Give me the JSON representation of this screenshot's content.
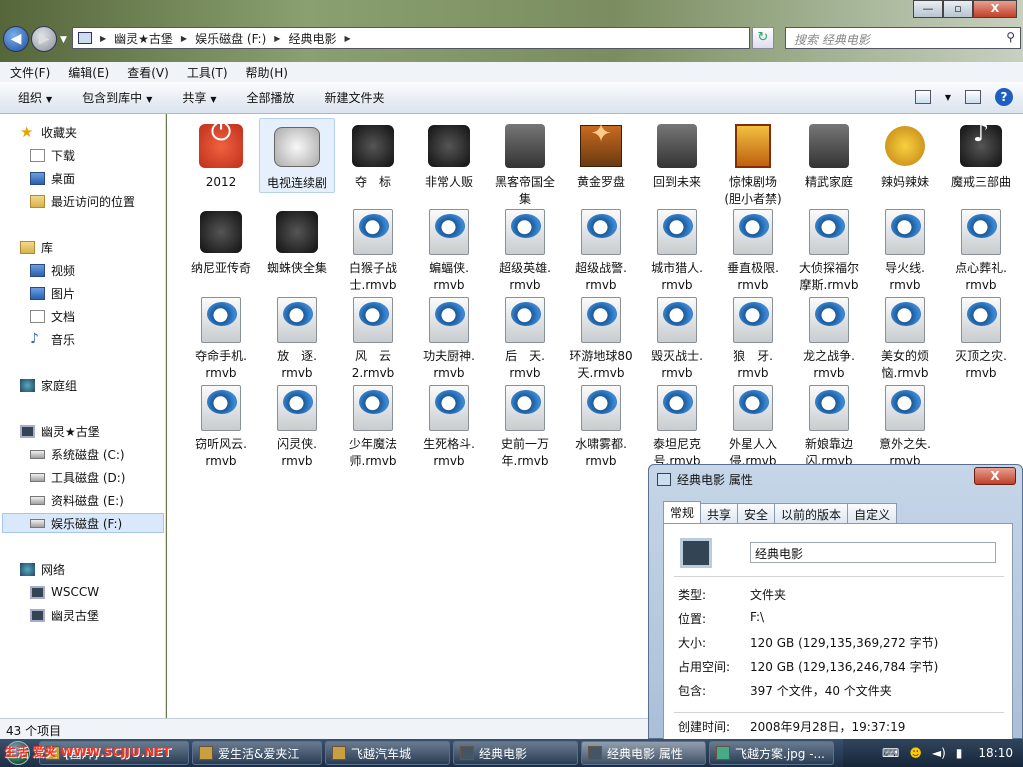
{
  "window": {
    "controls": {
      "minimize": "—",
      "maximize": "▫",
      "close": "X"
    },
    "address": {
      "crumbs": [
        "幽灵★古堡",
        "娱乐磁盘 (F:)",
        "经典电影"
      ]
    },
    "search_placeholder": "搜索 经典电影"
  },
  "menu": [
    "文件(F)",
    "编辑(E)",
    "查看(V)",
    "工具(T)",
    "帮助(H)"
  ],
  "toolbar": [
    {
      "label": "组织",
      "dropdown": true
    },
    {
      "label": "包含到库中",
      "dropdown": true
    },
    {
      "label": "共享",
      "dropdown": true
    },
    {
      "label": "全部播放",
      "dropdown": false
    },
    {
      "label": "新建文件夹",
      "dropdown": false
    }
  ],
  "nav": {
    "favorites": {
      "label": "收藏夹",
      "items": [
        "下载",
        "桌面",
        "最近访问的位置"
      ]
    },
    "libraries": {
      "label": "库",
      "items": [
        "视频",
        "图片",
        "文档",
        "音乐"
      ]
    },
    "homegroup": "家庭组",
    "computer": {
      "label": "幽灵★古堡",
      "items": [
        "系统磁盘 (C:)",
        "工具磁盘 (D:)",
        "资料磁盘 (E:)",
        "娱乐磁盘 (F:)"
      ]
    },
    "network": {
      "label": "网络",
      "items": [
        "WSCCW",
        "幽灵古堡"
      ]
    }
  },
  "files": [
    {
      "l1": "2012",
      "l2": "",
      "icon": "power-icon"
    },
    {
      "l1": "电视连续剧",
      "l2": "",
      "icon": "tv-icon"
    },
    {
      "l1": "夺　标",
      "l2": "",
      "icon": "robot-icon"
    },
    {
      "l1": "非常人贩",
      "l2": "",
      "icon": "folder-dark-icon"
    },
    {
      "l1": "黑客帝国全",
      "l2": "集",
      "icon": "box-icon"
    },
    {
      "l1": "黄金罗盘",
      "l2": "",
      "icon": "compass-box-icon"
    },
    {
      "l1": "回到未来",
      "l2": "",
      "icon": "gray-box-icon"
    },
    {
      "l1": "惊悚剧场",
      "l2": "(胆小者禁)",
      "icon": "poster-icon"
    },
    {
      "l1": "精武家庭",
      "l2": "",
      "icon": "gray-box-icon"
    },
    {
      "l1": "辣妈辣妹",
      "l2": "",
      "icon": "magnifier-icon"
    },
    {
      "l1": "魔戒三部曲",
      "l2": "",
      "icon": "music-disc-icon"
    },
    {
      "l1": "纳尼亚传奇",
      "l2": "",
      "icon": "machine-icon"
    },
    {
      "l1": "蜘蛛侠全集",
      "l2": "",
      "icon": "speaker-icon"
    },
    {
      "l1": "白猴子战",
      "l2": "士.rmvb",
      "icon": "rmvb-icon"
    },
    {
      "l1": "蝙蝠侠.",
      "l2": "rmvb",
      "icon": "rmvb-icon"
    },
    {
      "l1": "超级英雄.",
      "l2": "rmvb",
      "icon": "rmvb-icon"
    },
    {
      "l1": "超级战警.",
      "l2": "rmvb",
      "icon": "rmvb-icon"
    },
    {
      "l1": "城市猎人.",
      "l2": "rmvb",
      "icon": "rmvb-icon"
    },
    {
      "l1": "垂直极限.",
      "l2": "rmvb",
      "icon": "rmvb-icon"
    },
    {
      "l1": "大侦探福尔",
      "l2": "摩斯.rmvb",
      "icon": "rmvb-icon"
    },
    {
      "l1": "导火线.",
      "l2": "rmvb",
      "icon": "rmvb-icon"
    },
    {
      "l1": "点心葬礼.",
      "l2": "rmvb",
      "icon": "rmvb-icon"
    },
    {
      "l1": "夺命手机.",
      "l2": "rmvb",
      "icon": "rmvb-icon"
    },
    {
      "l1": "放　逐.",
      "l2": "rmvb",
      "icon": "rmvb-icon"
    },
    {
      "l1": "风　云",
      "l2": "2.rmvb",
      "icon": "rmvb-icon"
    },
    {
      "l1": "功夫厨神.",
      "l2": "rmvb",
      "icon": "rmvb-icon"
    },
    {
      "l1": "后　天.",
      "l2": "rmvb",
      "icon": "rmvb-icon"
    },
    {
      "l1": "环游地球80",
      "l2": "天.rmvb",
      "icon": "rmvb-icon"
    },
    {
      "l1": "毁灭战士.",
      "l2": "rmvb",
      "icon": "rmvb-icon"
    },
    {
      "l1": "狼　牙.",
      "l2": "rmvb",
      "icon": "rmvb-icon"
    },
    {
      "l1": "龙之战争.",
      "l2": "rmvb",
      "icon": "rmvb-icon"
    },
    {
      "l1": "美女的烦",
      "l2": "恼.rmvb",
      "icon": "rmvb-icon"
    },
    {
      "l1": "灭顶之灾.",
      "l2": "rmvb",
      "icon": "rmvb-icon"
    },
    {
      "l1": "窃听风云.",
      "l2": "rmvb",
      "icon": "rmvb-icon"
    },
    {
      "l1": "闪灵侠.",
      "l2": "rmvb",
      "icon": "rmvb-icon"
    },
    {
      "l1": "少年魔法",
      "l2": "师.rmvb",
      "icon": "rmvb-icon"
    },
    {
      "l1": "生死格斗.",
      "l2": "rmvb",
      "icon": "rmvb-icon"
    },
    {
      "l1": "史前一万",
      "l2": "年.rmvb",
      "icon": "rmvb-icon"
    },
    {
      "l1": "水啸雾都.",
      "l2": "rmvb",
      "icon": "rmvb-icon"
    },
    {
      "l1": "泰坦尼克",
      "l2": "号.rmvb",
      "icon": "rmvb-icon"
    },
    {
      "l1": "外星人入",
      "l2": "侵.rmvb",
      "icon": "rmvb-icon"
    },
    {
      "l1": "新娘靠边",
      "l2": "闪.rmvb",
      "icon": "rmvb-icon"
    },
    {
      "l1": "意外之失.",
      "l2": "rmvb",
      "icon": "rmvb-icon"
    }
  ],
  "status": "43 个项目",
  "dialog": {
    "title": "经典电影 属性",
    "close": "X",
    "tabs": [
      "常规",
      "共享",
      "安全",
      "以前的版本",
      "自定义"
    ],
    "name": "经典电影",
    "rows": [
      {
        "label": "类型:",
        "value": "文件夹"
      },
      {
        "label": "位置:",
        "value": "F:\\"
      },
      {
        "label": "大小:",
        "value": "120 GB (129,135,369,272 字节)"
      },
      {
        "label": "占用空间:",
        "value": "120 GB (129,136,246,784 字节)"
      },
      {
        "label": "包含:",
        "value": "397 个文件，40 个文件夹"
      },
      {
        "label": "创建时间:",
        "value": "2008年9月28日，19:37:19"
      }
    ]
  },
  "taskbar": {
    "buttons": [
      "[图片]",
      "爱生活&爱夹江",
      "飞越汽车城",
      "经典电影",
      "经典电影 属性",
      "飞越方案.jpg -..."
    ],
    "watermark": "生活  爱夹  WWW.SCJJU.NET",
    "time": "18:10"
  }
}
